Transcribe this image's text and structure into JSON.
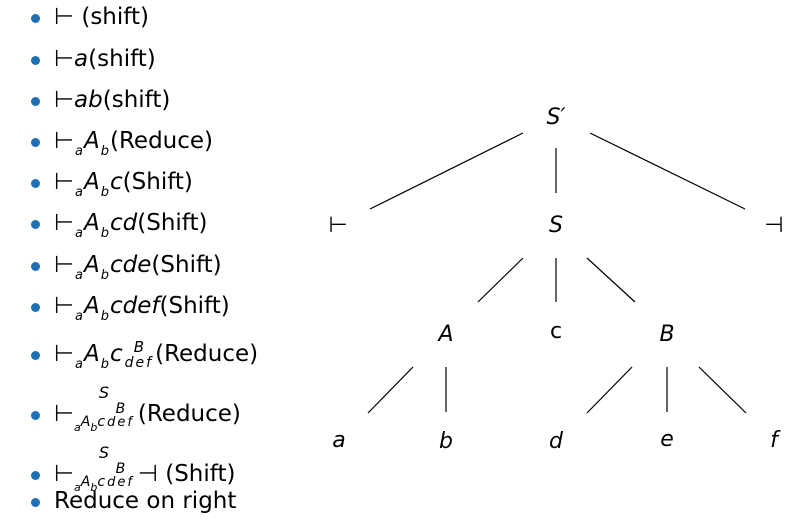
{
  "list": [
    {
      "parts": [
        {
          "t": "⊢ (shift)"
        }
      ]
    },
    {
      "parts": [
        {
          "t": "⊢ "
        },
        {
          "t": "a",
          "c": "it"
        },
        {
          "t": " (shift)"
        }
      ]
    },
    {
      "parts": [
        {
          "t": "⊢ "
        },
        {
          "t": "ab",
          "c": "it"
        },
        {
          "t": " (shift)"
        }
      ]
    },
    {
      "parts": [
        {
          "t": "⊢ "
        },
        {
          "t": "a",
          "c": "sub"
        },
        {
          "t": "A",
          "c": "it"
        },
        {
          "t": "b",
          "c": "sub"
        },
        {
          "t": " (Reduce)"
        }
      ]
    },
    {
      "parts": [
        {
          "t": "⊢ "
        },
        {
          "t": "a",
          "c": "sub"
        },
        {
          "t": "A",
          "c": "it"
        },
        {
          "t": "b",
          "c": "sub"
        },
        {
          "t": "c",
          "c": "it"
        },
        {
          "t": " (Shift)"
        }
      ]
    },
    {
      "parts": [
        {
          "t": "⊢ "
        },
        {
          "t": "a",
          "c": "sub"
        },
        {
          "t": "A",
          "c": "it"
        },
        {
          "t": "b",
          "c": "sub"
        },
        {
          "t": "cd",
          "c": "it"
        },
        {
          "t": " (Shift)"
        }
      ]
    },
    {
      "parts": [
        {
          "t": "⊢ "
        },
        {
          "t": "a",
          "c": "sub"
        },
        {
          "t": "A",
          "c": "it"
        },
        {
          "t": "b",
          "c": "sub"
        },
        {
          "t": "cde",
          "c": "it"
        },
        {
          "t": " (Shift)"
        }
      ]
    },
    {
      "parts": [
        {
          "t": "⊢ "
        },
        {
          "t": "a",
          "c": "sub"
        },
        {
          "t": "A",
          "c": "it"
        },
        {
          "t": "b",
          "c": "sub"
        },
        {
          "t": "cdef",
          "c": "it"
        },
        {
          "t": " (Shift)"
        }
      ]
    },
    {
      "parts": [
        {
          "t": "⊢ "
        },
        {
          "t": "a",
          "c": "sub"
        },
        {
          "t": "A",
          "c": "it"
        },
        {
          "t": "b",
          "c": "sub"
        },
        {
          "t": "c",
          "c": "it"
        },
        {
          "c": "stack",
          "top": "B",
          "bot": "def"
        },
        {
          "t": " (Reduce)"
        }
      ]
    },
    {
      "parts": [
        {
          "t": "⊢ "
        },
        {
          "c": "nest",
          "top": "S",
          "a": "a",
          "A": "A",
          "b": "b",
          "cc": "c",
          "B": "B",
          "bot": "def"
        },
        {
          "t": " (Reduce)"
        }
      ]
    },
    {
      "parts": [
        {
          "t": "⊢ "
        },
        {
          "c": "nest",
          "top": "S",
          "a": "a",
          "A": "A",
          "b": "b",
          "cc": "c",
          "B": "B",
          "bot": "def"
        },
        {
          "t": " ⊣ (Shift)"
        }
      ]
    },
    {
      "parts": [
        {
          "t": "Reduce on right"
        }
      ]
    }
  ],
  "tree": {
    "nodes": {
      "root": "S′",
      "left_turnstile": "⊢",
      "S": "S",
      "right_turnstile": "⊣",
      "A": "A",
      "c": "c",
      "B": "B",
      "a": "a",
      "b": "b",
      "d": "d",
      "e": "e",
      "f": "f"
    }
  },
  "colors": {
    "bullet": "#1f6fb5",
    "line": "#000000"
  }
}
